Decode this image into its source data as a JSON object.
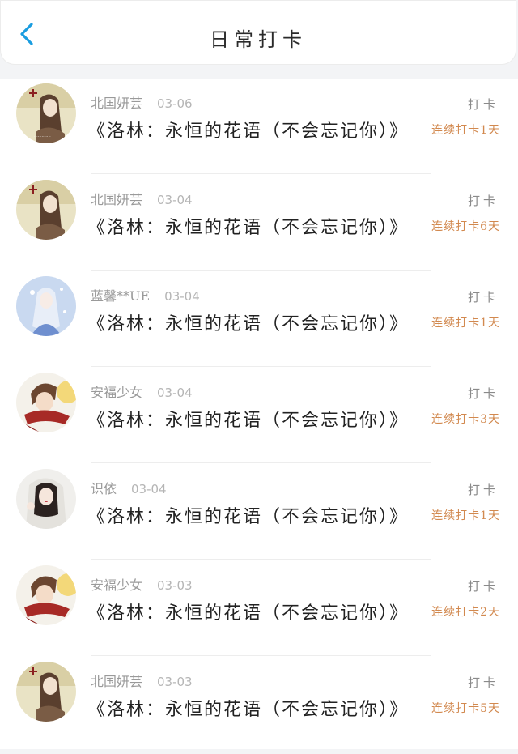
{
  "header": {
    "title": "日常打卡"
  },
  "entries": [
    {
      "user": "北国妍芸",
      "date": "03-06",
      "book": "《洛林：永恒的花语（不会忘记你）》",
      "action": "打卡",
      "streak": "连续打卡1天",
      "avatar": "avatar-girl-sepia"
    },
    {
      "user": "北国妍芸",
      "date": "03-04",
      "book": "《洛林：永恒的花语（不会忘记你）》",
      "action": "打卡",
      "streak": "连续打卡6天",
      "avatar": "avatar-girl-sepia"
    },
    {
      "user": "蓝馨**UE",
      "date": "03-04",
      "book": "《洛林：永恒的花语（不会忘记你）》",
      "action": "打卡",
      "streak": "连续打卡1天",
      "avatar": "avatar-blue-fairy"
    },
    {
      "user": "安福少女",
      "date": "03-04",
      "book": "《洛林：永恒的花语（不会忘记你）》",
      "action": "打卡",
      "streak": "连续打卡3天",
      "avatar": "avatar-boy-scarf"
    },
    {
      "user": "识依",
      "date": "03-04",
      "book": "《洛林：永恒的花语（不会忘记你）》",
      "action": "打卡",
      "streak": "连续打卡1天",
      "avatar": "avatar-girl-hood"
    },
    {
      "user": "安福少女",
      "date": "03-03",
      "book": "《洛林：永恒的花语（不会忘记你）》",
      "action": "打卡",
      "streak": "连续打卡2天",
      "avatar": "avatar-boy-scarf"
    },
    {
      "user": "北国妍芸",
      "date": "03-03",
      "book": "《洛林：永恒的花语（不会忘记你）》",
      "action": "打卡",
      "streak": "连续打卡5天",
      "avatar": "avatar-girl-sepia"
    }
  ]
}
